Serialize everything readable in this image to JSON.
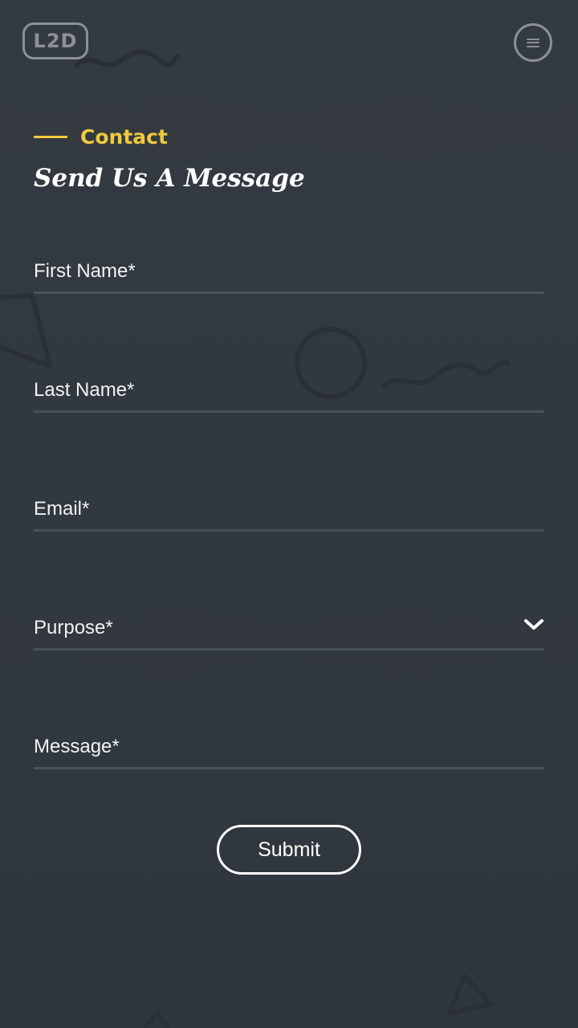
{
  "header": {
    "logo_text": "L2D",
    "menu_icon": "hamburger-menu-icon"
  },
  "section": {
    "eyebrow": "Contact",
    "title": "Send Us A Message"
  },
  "form": {
    "fields": [
      {
        "label": "First Name*",
        "type": "text"
      },
      {
        "label": "Last Name*",
        "type": "text"
      },
      {
        "label": "Email*",
        "type": "email"
      },
      {
        "label": "Purpose*",
        "type": "select",
        "icon": "chevron-down-icon"
      },
      {
        "label": "Message*",
        "type": "textarea"
      }
    ],
    "submit_label": "Submit"
  },
  "colors": {
    "background": "#323840",
    "accent": "#f0c93e",
    "text": "#ffffff",
    "muted": "#8d9096",
    "divider": "#4a5058"
  }
}
